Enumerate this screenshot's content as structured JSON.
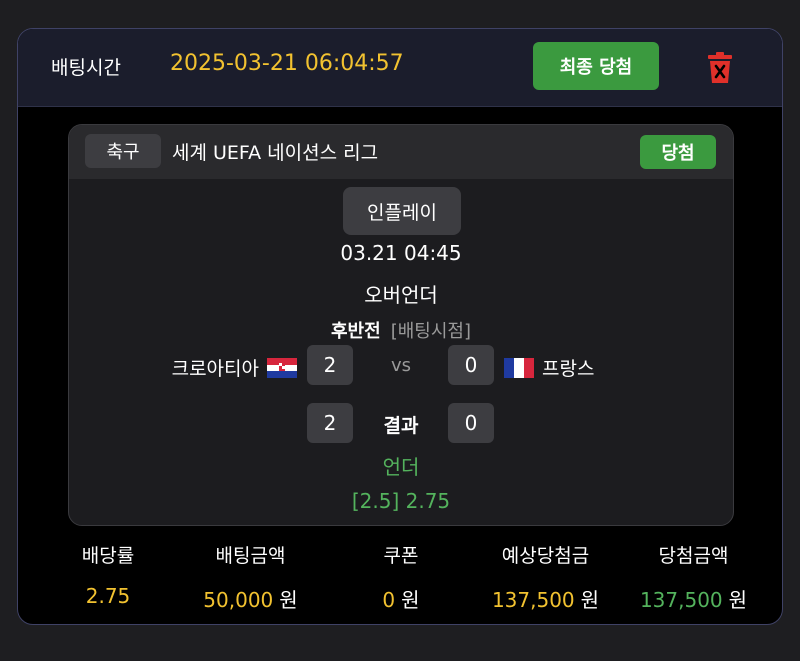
{
  "header": {
    "bet_time_label": "배팅시간",
    "bet_time_value": "2025-03-21 06:04:57",
    "final_win_label": "최종 당첨",
    "delete_icon": "trash-icon"
  },
  "match": {
    "sport": "축구",
    "league": "세계 UEFA 네이션스 리그",
    "status_badge": "당첨",
    "inplay": "인플레이",
    "time": "03.21 04:45",
    "market": "오버언더",
    "period": "후반전",
    "bet_point_label": "[배팅시점]",
    "home_team": "크로아티아",
    "away_team": "프랑스",
    "home_score_at_bet": "2",
    "away_score_at_bet": "0",
    "vs": "vs",
    "result_label": "결과",
    "home_score_result": "2",
    "away_score_result": "0",
    "pick": "언더",
    "odds_line": "[2.5] 2.75"
  },
  "summary": {
    "odds_label": "배당률",
    "odds_value": "2.75",
    "bet_amount_label": "배팅금액",
    "bet_amount_value": "50,000",
    "coupon_label": "쿠폰",
    "coupon_value": "0",
    "expected_win_label": "예상당첨금",
    "expected_win_value": "137,500",
    "win_amount_label": "당첨금액",
    "win_amount_value": "137,500",
    "currency_unit": "원"
  },
  "colors": {
    "accent_yellow": "#f2c230",
    "accent_green": "#54b35d",
    "button_green": "#3b9a3f",
    "delete_red": "#e0302a"
  }
}
